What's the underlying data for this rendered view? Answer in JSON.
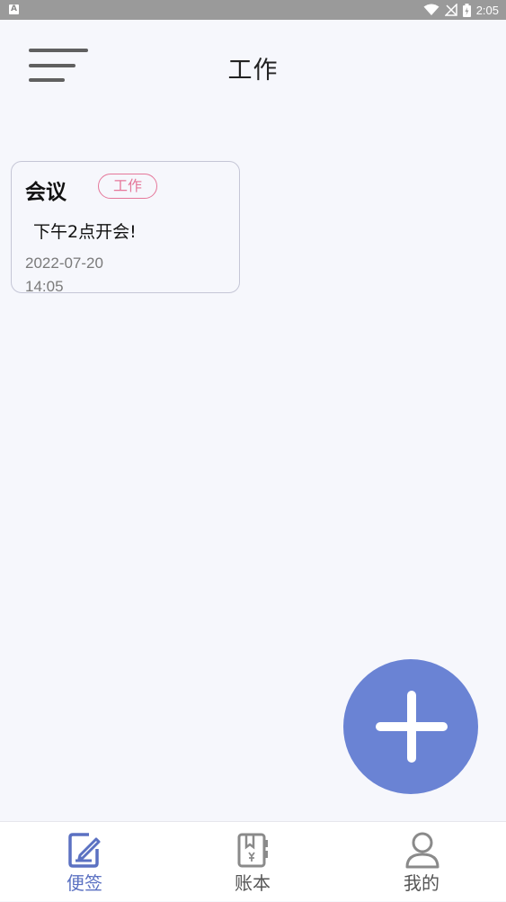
{
  "status_bar": {
    "app_icon": "A",
    "time": "2:05",
    "icons": [
      "wifi-icon",
      "no-signal-icon",
      "battery-charging-icon"
    ]
  },
  "header": {
    "title": "工作",
    "menu_icon": "hamburger-menu-icon"
  },
  "notes": [
    {
      "title": "会议",
      "tag": "工作",
      "content": "下午2点开会!",
      "date": "2022-07-20",
      "time": "14:05"
    }
  ],
  "fab": {
    "icon": "plus-icon"
  },
  "bottom_nav": {
    "items": [
      {
        "label": "便签",
        "icon": "note-edit-icon",
        "active": true
      },
      {
        "label": "账本",
        "icon": "ledger-book-icon",
        "active": false
      },
      {
        "label": "我的",
        "icon": "user-profile-icon",
        "active": false
      }
    ]
  },
  "colors": {
    "accent": "#6a83d4",
    "nav_active": "#5b71c2",
    "tag": "#e5779a",
    "background": "#f6f7fc",
    "status_bar": "#9a9a9a"
  }
}
